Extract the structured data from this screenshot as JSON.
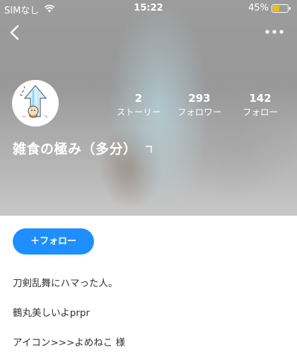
{
  "status_bar": {
    "carrier": "SIMなし",
    "time": "15:22",
    "battery_percent_label": "45%",
    "battery_level": 0.45
  },
  "nav": {
    "back_icon": "chevron-left-icon",
    "more_icon": "more-horizontal-icon"
  },
  "profile": {
    "name": "雑食の極み（多分）",
    "stats": [
      {
        "value": "2",
        "label": "ストーリー"
      },
      {
        "value": "293",
        "label": "フォロワー"
      },
      {
        "value": "142",
        "label": "フォロー"
      }
    ]
  },
  "actions": {
    "follow_label": "＋フォロー"
  },
  "bio": [
    "刀剣乱舞にハマった人。",
    "鶴丸美しいよprpr",
    "アイコン>>>よめねこ 様"
  ],
  "colors": {
    "accent": "#1f8fff",
    "battery": "#f6c000"
  }
}
